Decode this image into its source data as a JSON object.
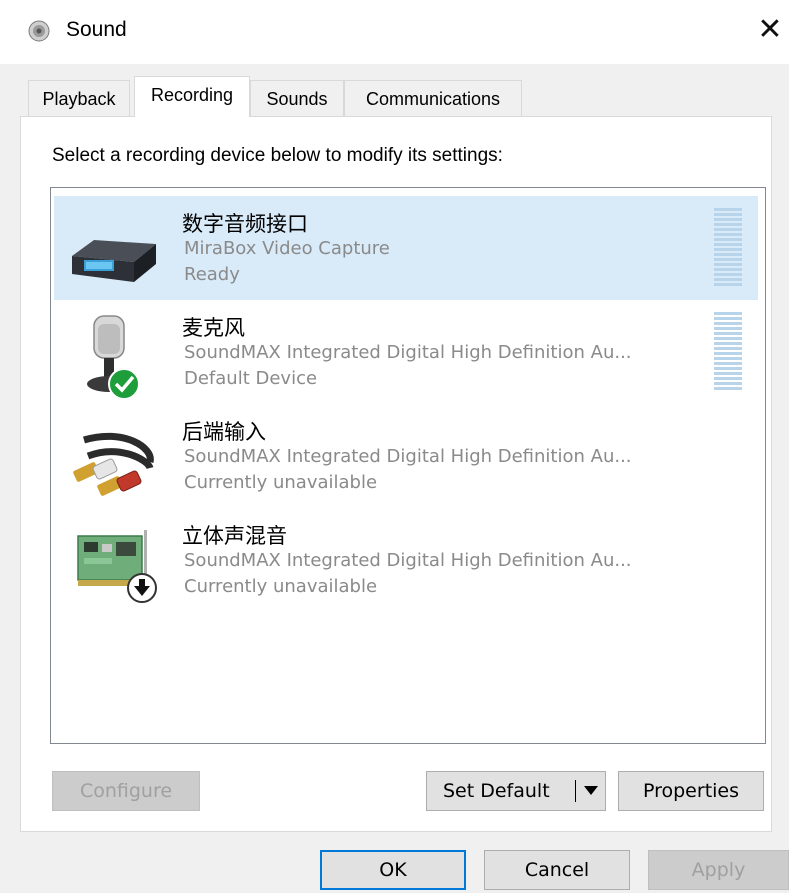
{
  "window": {
    "title": "Sound",
    "close_glyph": "✕"
  },
  "tabs": [
    {
      "label": "Playback",
      "active": false
    },
    {
      "label": "Recording",
      "active": true
    },
    {
      "label": "Sounds",
      "active": false
    },
    {
      "label": "Communications",
      "active": false
    }
  ],
  "instruction": "Select a recording device below to modify its settings:",
  "devices": [
    {
      "name": "数字音频接口",
      "description": "MiraBox Video Capture",
      "status": "Ready",
      "icon": "capture-device-icon",
      "selected": true,
      "has_meter": true
    },
    {
      "name": "麦克风",
      "description": "SoundMAX Integrated Digital High Definition Au...",
      "status": "Default Device",
      "icon": "microphone-icon",
      "selected": false,
      "has_meter": true,
      "badge": "default-check-badge"
    },
    {
      "name": "后端输入",
      "description": "SoundMAX Integrated Digital High Definition Au...",
      "status": "Currently unavailable",
      "icon": "rca-cable-icon",
      "selected": false,
      "has_meter": false
    },
    {
      "name": "立体声混音",
      "description": "SoundMAX Integrated Digital High Definition Au...",
      "status": "Currently unavailable",
      "icon": "sound-card-icon",
      "selected": false,
      "has_meter": false,
      "badge": "disabled-arrow-badge"
    }
  ],
  "buttons": {
    "configure": "Configure",
    "set_default": "Set Default",
    "properties": "Properties",
    "ok": "OK",
    "cancel": "Cancel",
    "apply": "Apply"
  },
  "colors": {
    "selection": "#d9ebf9",
    "accent": "#0078d7",
    "default_badge": "#1e9e3a",
    "meter": "#b8d4ea"
  }
}
